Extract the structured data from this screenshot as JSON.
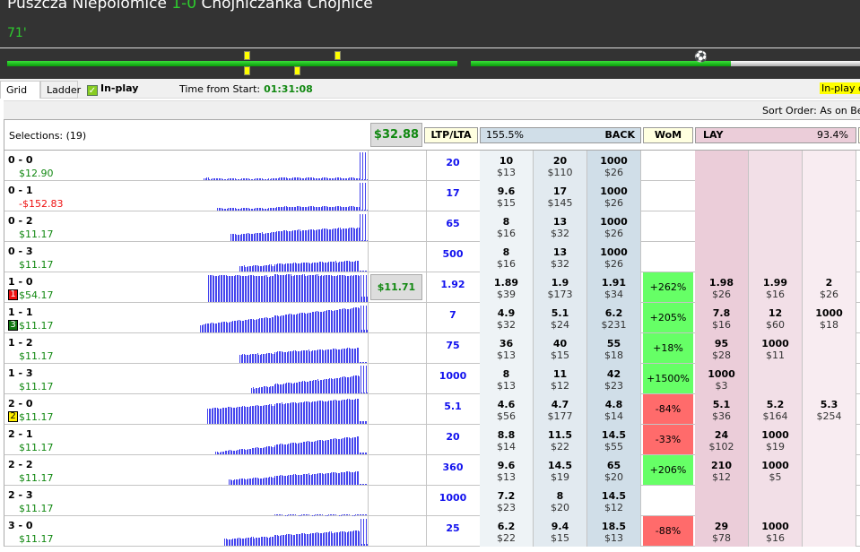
{
  "header": {
    "home": "Puszcza Niepolomice",
    "score": "1-0",
    "away": "Chojniczanka Chojnice",
    "minute": "71'",
    "match_progress_second_half": 0.7
  },
  "tabs": [
    {
      "label": "Grid"
    },
    {
      "label": "Ladder"
    }
  ],
  "inplay": {
    "label": "In-play",
    "checked": true
  },
  "time_from_start": {
    "label": "Time from Start:",
    "value": "01:31:08"
  },
  "inplay_delay": "In-play d",
  "sort_order": "Sort Order: As on Betf",
  "market": {
    "selections": "Selections: (19)",
    "total_pl": "$32.88",
    "ltp_header": "LTP/LTA",
    "back_pct": "155.5%",
    "back_label": "BACK",
    "wom_label": "WoM",
    "lay_label": "LAY",
    "lay_pct": "93.4%"
  },
  "colors": {
    "back1": "#eef3f6",
    "back2": "#e2eaf0",
    "back3": "#d0dee8",
    "lay1": "#ebcdd9",
    "lay2": "#f2dfe7",
    "lay3": "#f8ecf1",
    "wom_pos": "#66ff66",
    "wom_neg": "#ff6b6b"
  },
  "rows": [
    {
      "name": "0 - 0",
      "pl": "$12.90",
      "ltp": "20",
      "back": [
        [
          "10",
          "$13"
        ],
        [
          "20",
          "$110"
        ],
        [
          "1000",
          "$26"
        ]
      ],
      "wom": "",
      "lay": [
        [
          "",
          ""
        ],
        [
          "",
          ""
        ],
        [
          "",
          ""
        ]
      ]
    },
    {
      "name": "0 - 1",
      "pl": "-$152.83",
      "neg": true,
      "ltp": "17",
      "back": [
        [
          "9.6",
          "$15"
        ],
        [
          "17",
          "$145"
        ],
        [
          "1000",
          "$26"
        ]
      ],
      "wom": "",
      "lay": [
        [
          "",
          ""
        ],
        [
          "",
          ""
        ],
        [
          "",
          ""
        ]
      ]
    },
    {
      "name": "0 - 2",
      "pl": "$11.17",
      "ltp": "65",
      "back": [
        [
          "8",
          "$16"
        ],
        [
          "13",
          "$32"
        ],
        [
          "1000",
          "$26"
        ]
      ],
      "wom": "",
      "lay": [
        [
          "",
          ""
        ],
        [
          "",
          ""
        ],
        [
          "",
          ""
        ]
      ]
    },
    {
      "name": "0 - 3",
      "pl": "$11.17",
      "ltp": "500",
      "back": [
        [
          "8",
          "$16"
        ],
        [
          "13",
          "$32"
        ],
        [
          "1000",
          "$26"
        ]
      ],
      "wom": "",
      "lay": [
        [
          "",
          ""
        ],
        [
          "",
          ""
        ],
        [
          "",
          ""
        ]
      ]
    },
    {
      "name": "1 - 0",
      "pl": "$54.17",
      "badge": "1",
      "badge_color": "#ee1111",
      "row_pl": "$11.71",
      "ltp": "1.92",
      "back": [
        [
          "1.89",
          "$39"
        ],
        [
          "1.9",
          "$173"
        ],
        [
          "1.91",
          "$34"
        ]
      ],
      "wom": "+262%",
      "lay": [
        [
          "1.98",
          "$26"
        ],
        [
          "1.99",
          "$16"
        ],
        [
          "2",
          "$26"
        ]
      ]
    },
    {
      "name": "1 - 1",
      "pl": "$11.17",
      "badge": "3",
      "badge_color": "#117711",
      "ltp": "7",
      "back": [
        [
          "4.9",
          "$32"
        ],
        [
          "5.1",
          "$24"
        ],
        [
          "6.2",
          "$231"
        ]
      ],
      "wom": "+205%",
      "lay": [
        [
          "7.8",
          "$16"
        ],
        [
          "12",
          "$60"
        ],
        [
          "1000",
          "$18"
        ]
      ]
    },
    {
      "name": "1 - 2",
      "pl": "$11.17",
      "ltp": "75",
      "back": [
        [
          "36",
          "$13"
        ],
        [
          "40",
          "$15"
        ],
        [
          "55",
          "$18"
        ]
      ],
      "wom": "+18%",
      "lay": [
        [
          "95",
          "$28"
        ],
        [
          "1000",
          "$11"
        ],
        [
          "",
          ""
        ]
      ]
    },
    {
      "name": "1 - 3",
      "pl": "$11.17",
      "ltp": "1000",
      "back": [
        [
          "8",
          "$13"
        ],
        [
          "11",
          "$12"
        ],
        [
          "42",
          "$23"
        ]
      ],
      "wom": "+1500%",
      "lay": [
        [
          "1000",
          "$3"
        ],
        [
          "",
          ""
        ],
        [
          "",
          ""
        ]
      ]
    },
    {
      "name": "2 - 0",
      "pl": "$11.17",
      "badge": "2",
      "badge_color": "#ffee00",
      "ltp": "5.1",
      "back": [
        [
          "4.6",
          "$56"
        ],
        [
          "4.7",
          "$177"
        ],
        [
          "4.8",
          "$14"
        ]
      ],
      "wom": "-84%",
      "lay": [
        [
          "5.1",
          "$36"
        ],
        [
          "5.2",
          "$164"
        ],
        [
          "5.3",
          "$254"
        ]
      ]
    },
    {
      "name": "2 - 1",
      "pl": "$11.17",
      "ltp": "20",
      "back": [
        [
          "8.8",
          "$14"
        ],
        [
          "11.5",
          "$22"
        ],
        [
          "14.5",
          "$55"
        ]
      ],
      "wom": "-33%",
      "lay": [
        [
          "24",
          "$102"
        ],
        [
          "1000",
          "$19"
        ],
        [
          "",
          ""
        ]
      ]
    },
    {
      "name": "2 - 2",
      "pl": "$11.17",
      "ltp": "360",
      "back": [
        [
          "9.6",
          "$13"
        ],
        [
          "14.5",
          "$19"
        ],
        [
          "65",
          "$20"
        ]
      ],
      "wom": "+206%",
      "lay": [
        [
          "210",
          "$12"
        ],
        [
          "1000",
          "$5"
        ],
        [
          "",
          ""
        ]
      ]
    },
    {
      "name": "2 - 3",
      "pl": "$11.17",
      "ltp": "1000",
      "back": [
        [
          "7.2",
          "$23"
        ],
        [
          "8",
          "$20"
        ],
        [
          "14.5",
          "$12"
        ]
      ],
      "wom": "",
      "lay": [
        [
          "",
          ""
        ],
        [
          "",
          ""
        ],
        [
          "",
          ""
        ]
      ]
    },
    {
      "name": "3 - 0",
      "pl": "$11.17",
      "ltp": "25",
      "back": [
        [
          "6.2",
          "$22"
        ],
        [
          "9.4",
          "$15"
        ],
        [
          "18.5",
          "$13"
        ]
      ],
      "wom": "-88%",
      "lay": [
        [
          "29",
          "$78"
        ],
        [
          "1000",
          "$16"
        ],
        [
          "",
          ""
        ]
      ]
    }
  ]
}
